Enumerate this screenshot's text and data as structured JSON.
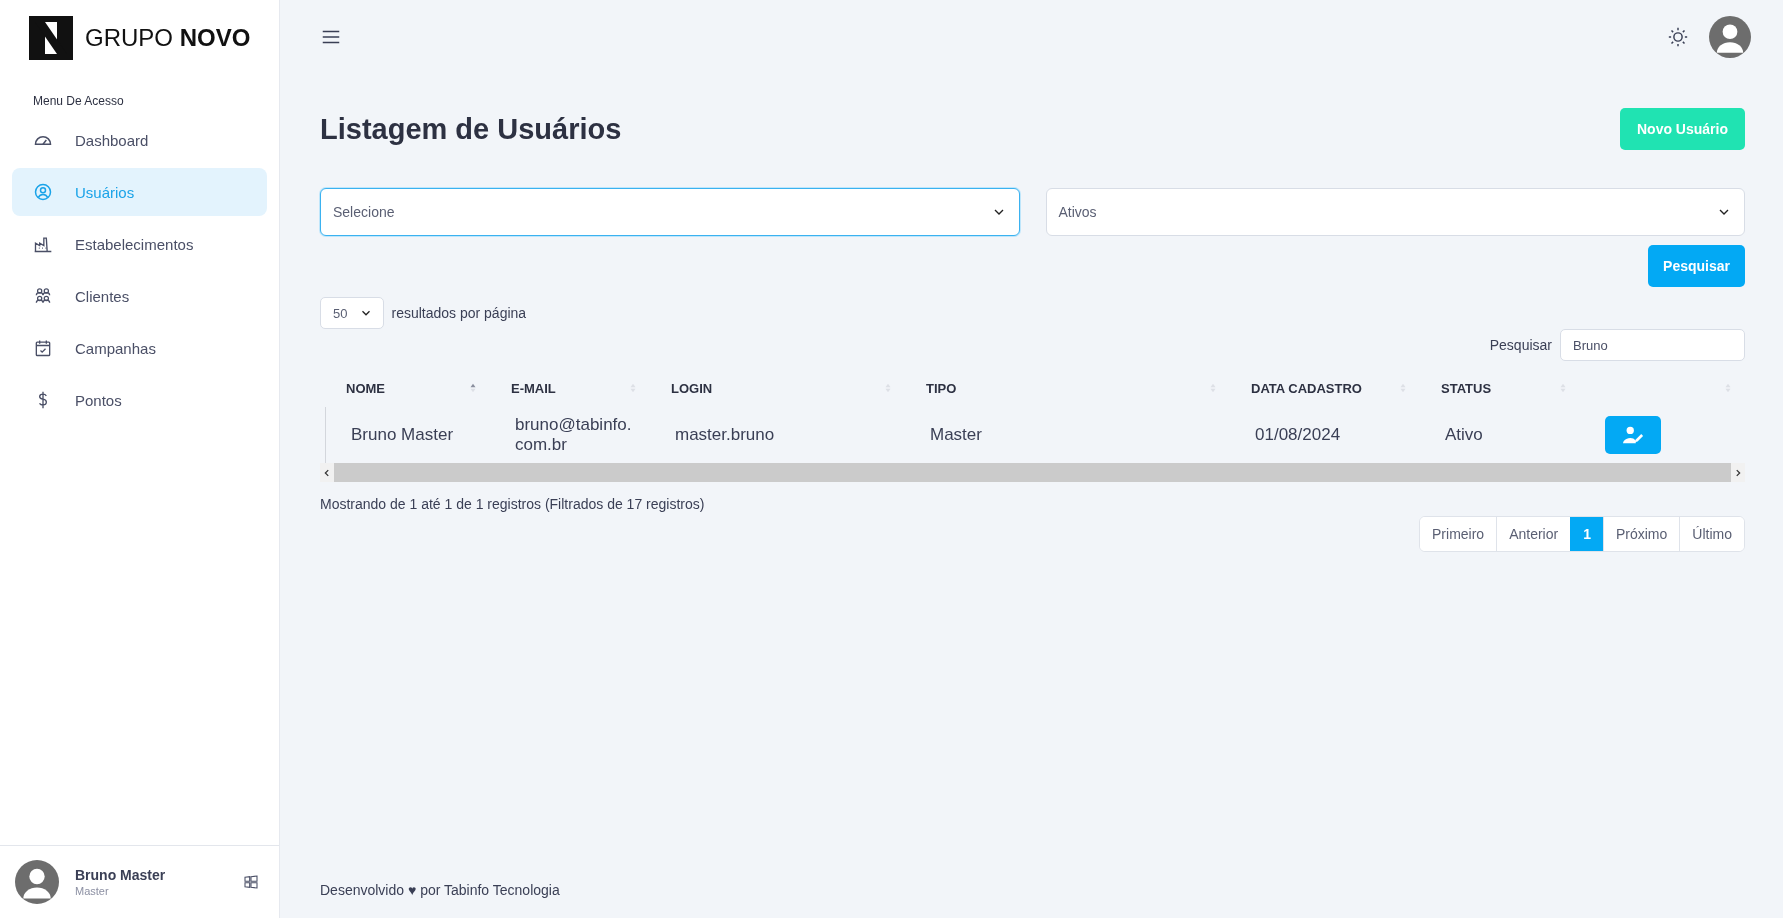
{
  "sidebar": {
    "logo": {
      "text_light": "GRUPO",
      "text_bold": "NOVO"
    },
    "section_title": "Menu De Acesso",
    "items": [
      {
        "label": "Dashboard",
        "selected": false
      },
      {
        "label": "Usuários",
        "selected": true
      },
      {
        "label": "Estabelecimentos",
        "selected": false
      },
      {
        "label": "Clientes",
        "selected": false
      },
      {
        "label": "Campanhas",
        "selected": false
      },
      {
        "label": "Pontos",
        "selected": false
      }
    ],
    "user": {
      "name": "Bruno Master",
      "role": "Master"
    }
  },
  "page": {
    "title": "Listagem de Usuários",
    "new_button": "Novo Usuário"
  },
  "filters": [
    {
      "value": "Selecione",
      "focused": true
    },
    {
      "value": "Ativos",
      "focused": false
    }
  ],
  "search_button": "Pesquisar",
  "table": {
    "page_size": "50",
    "page_size_label": "resultados por página",
    "search_label": "Pesquisar",
    "search_value": "Bruno",
    "columns": [
      {
        "label": "NOME",
        "sorted": true
      },
      {
        "label": "E-MAIL",
        "sorted": false
      },
      {
        "label": "LOGIN",
        "sorted": false
      },
      {
        "label": "TIPO",
        "sorted": false
      },
      {
        "label": "DATA CADASTRO",
        "sorted": false
      },
      {
        "label": "STATUS",
        "sorted": false
      },
      {
        "sorted": false
      }
    ],
    "rows": [
      {
        "cells": [
          "Bruno Master",
          "bruno@tabinfo.com.br",
          "master.bruno",
          "Master",
          "01/08/2024",
          "Ativo"
        ]
      }
    ],
    "info": "Mostrando de 1 até 1 de 1 registros (Filtrados de 17 registros)",
    "pagination": [
      {
        "label": "Primeiro",
        "selected": false
      },
      {
        "label": "Anterior",
        "selected": false
      },
      {
        "label": "1",
        "selected": true
      },
      {
        "label": "Próximo",
        "selected": false
      },
      {
        "label": "Último",
        "selected": false
      }
    ]
  },
  "footer": {
    "text": "Desenvolvido ♥ por Tabinfo Tecnologia"
  }
}
